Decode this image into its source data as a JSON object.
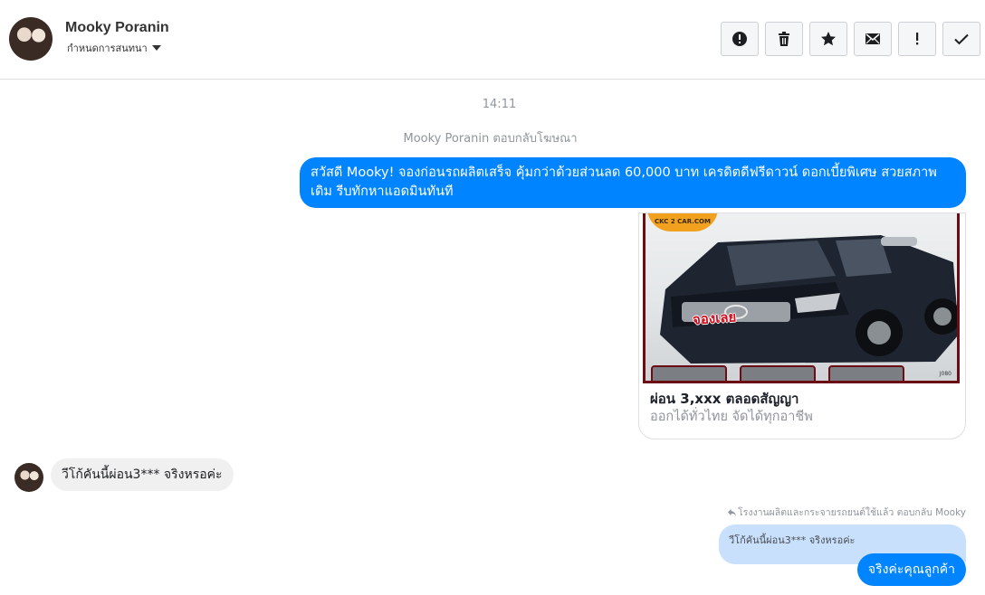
{
  "header": {
    "contact_name": "Mooky Poranin",
    "manage_label": "กำหนดการสนทนา",
    "actions": [
      {
        "icon": "alert-circle-icon",
        "label": "Mark as spam"
      },
      {
        "icon": "trash-icon",
        "label": "Delete"
      },
      {
        "icon": "star-icon",
        "label": "Star"
      },
      {
        "icon": "envelope-icon",
        "label": "Mark as unread"
      },
      {
        "icon": "exclamation-icon",
        "label": "Priority"
      },
      {
        "icon": "checkmark-icon",
        "label": "Mark as done"
      }
    ]
  },
  "conversation": {
    "timestamp": "14:11",
    "ad_reply_note": "Mooky Poranin ตอบกลับโฆษณา",
    "outgoing_message": "สวัสดี Mooky! จองก่อนรถผลิตเสร็จ คุ้มกว่าด้วยส่วนลด 60,000 บาท เครดิตดีฟรีดาวน์ ดอกเบี้ยพิเศษ สวยสภาพเดิม รีบทักหาแอดมินทันที",
    "ad_card": {
      "image_logo": "CKC 2 CAR.COM",
      "image_stamp": "จองเลย",
      "image_watermark": "J080",
      "title": "ผ่อน 3,xxx ตลอดสัญญา",
      "subtitle": "ออกได้ทั่วไทย จัดได้ทุกอาชีพ"
    },
    "incoming_message": "วีโก้คันนี้ผ่อน3*** จริงหรอค่ะ",
    "reply_context": "โรงงานผลิตและกระจายรถยนต์ใช้แล้ว ตอบกลับ Mooky",
    "quoted_message": "วีโก้คันนี้ผ่อน3*** จริงหรอค่ะ",
    "reply_message": "จริงค่ะคุณลูกค้า"
  },
  "colors": {
    "accent": "#0084ff",
    "quoted_bg": "#c9e0fc",
    "incoming_bg": "#f1f0f0"
  }
}
